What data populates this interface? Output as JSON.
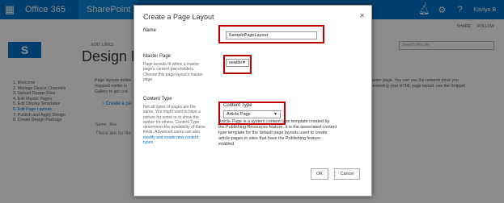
{
  "suite_bar": {
    "brand": "Office 365",
    "app": "SharePoint",
    "notification_count": "1",
    "icons": [
      "app-launcher-icon",
      "bell-icon",
      "gear-icon",
      "help-icon"
    ],
    "user": "Kaviya B"
  },
  "page": {
    "share": "SHARE",
    "follow": "FOLLOW",
    "edit_links": "EDIT LINKS",
    "logo": "S",
    "title": "Design Ma",
    "search_placeholder": "Search this site",
    "steps": [
      "1. Welcome",
      "2. Manage Device Channels",
      "3. Upload Design Files",
      "4. Edit Master Pages",
      "5. Edit Display Templates",
      "6. Edit Page Layouts",
      "7. Publish and Apply Design",
      "8. Create Design Package"
    ],
    "intro_lines": [
      "Page layouts define",
      "mapped earlier to",
      "Gallery to get cod"
    ],
    "intro_right_lines": [
      "master page. You can use the network drive you",
      "previewing your HTML page layout, use the Snippet"
    ],
    "create_link": "Create a pa",
    "col_name": "Name",
    "col_rest": "Res",
    "no_files": "There are no file"
  },
  "dialog": {
    "title": "Create a Page Layout",
    "name_label": "Name",
    "name_value": "SamplePageLayout",
    "master_label": "Master Page",
    "master_desc_lines": [
      "Page layouts fit within a master",
      "page's content placeholders.",
      "Choose this page layout's master",
      "page."
    ],
    "master_value": "seattle",
    "ct_section_label": "Content Type",
    "ct_desc_lines": [
      "Not all types of pages are the",
      "same. You might want to have a",
      "picture for some or to show the",
      "author for others. Content Type",
      "determines the availability of these",
      "fields. Advanced users can also"
    ],
    "ct_desc_link_lines": [
      "modify and create new content",
      "types"
    ],
    "ct_field_label": "Content Type",
    "ct_value": "Article Page",
    "ct_info_lines": [
      "Article Page is a system content type template created by",
      "the Publishing Resources feature. It is the associated content",
      "type template for the default page layouts used to create",
      "article pages in sites that have the Publishing feature",
      "enabled."
    ],
    "ok_label": "OK",
    "cancel_label": "Cancel",
    "close_glyph": "✕"
  },
  "colors": {
    "suite_blue": "#0072c6",
    "highlight_red": "#c00000"
  }
}
